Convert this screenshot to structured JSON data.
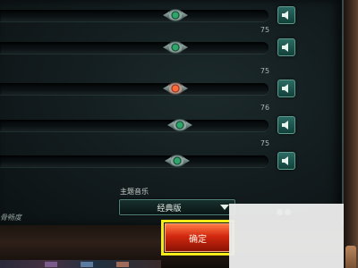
{
  "sliders": [
    {
      "value": "75"
    },
    {
      "value": "75"
    },
    {
      "value": "75"
    },
    {
      "value": "76"
    },
    {
      "value": "75"
    }
  ],
  "music": {
    "label": "主题音乐",
    "selected": "经典版"
  },
  "partial_label": "骨畅度",
  "confirm_label": "确定",
  "colors": {
    "accent_green": "#2ea66a",
    "confirm_red": "#d22810",
    "highlight_yellow": "#f3ec1a",
    "active_knob": "#ff6a3a"
  },
  "icons": {
    "volume": "speaker-icon",
    "dropdown": "chevron-down-icon"
  }
}
